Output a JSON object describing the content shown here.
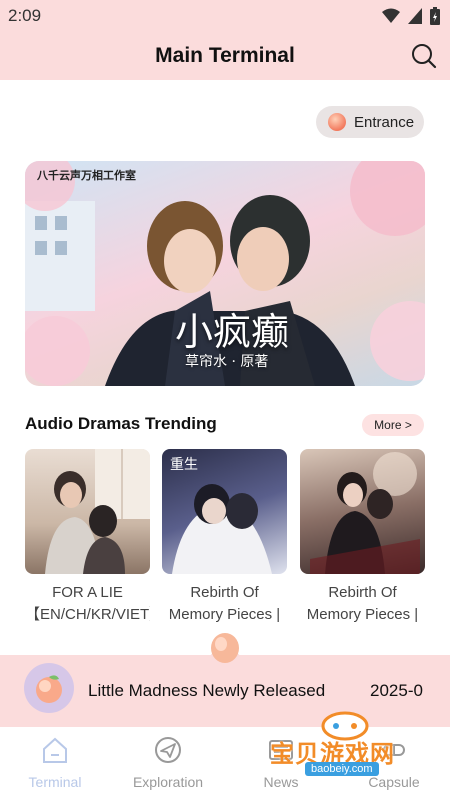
{
  "status_bar": {
    "time": "2:09"
  },
  "header": {
    "title": "Main Terminal"
  },
  "entrance": {
    "label": "Entrance"
  },
  "banner": {
    "studio": "八千云声万相工作室",
    "title": "小疯癫",
    "subtitle": "草帘水 · 原著"
  },
  "trending": {
    "title": "Audio Dramas Trending",
    "more_label": "More >",
    "cards": [
      {
        "title": "FOR A LIE 【EN/CH/KR/VIET】"
      },
      {
        "title": "Rebirth Of Memory Pieces | 重生"
      },
      {
        "title": "Rebirth Of Memory Pieces | 重生"
      }
    ]
  },
  "release_banner": {
    "text": "Little Madness Newly Released",
    "date": "2025-0"
  },
  "nav": {
    "items": [
      {
        "label": "Terminal",
        "icon": "home-icon",
        "active": true
      },
      {
        "label": "Exploration",
        "icon": "paper-plane-icon",
        "active": false
      },
      {
        "label": "News",
        "icon": "news-icon",
        "active": false
      },
      {
        "label": "Capsule",
        "icon": "capsule-icon",
        "active": false
      }
    ]
  },
  "watermark": {
    "text": "宝贝游戏网",
    "url": "baobeiy.com"
  },
  "colors": {
    "header_bg": "#fbdcdc",
    "active_nav": "#b8c8e8",
    "inactive_nav": "#999999"
  }
}
